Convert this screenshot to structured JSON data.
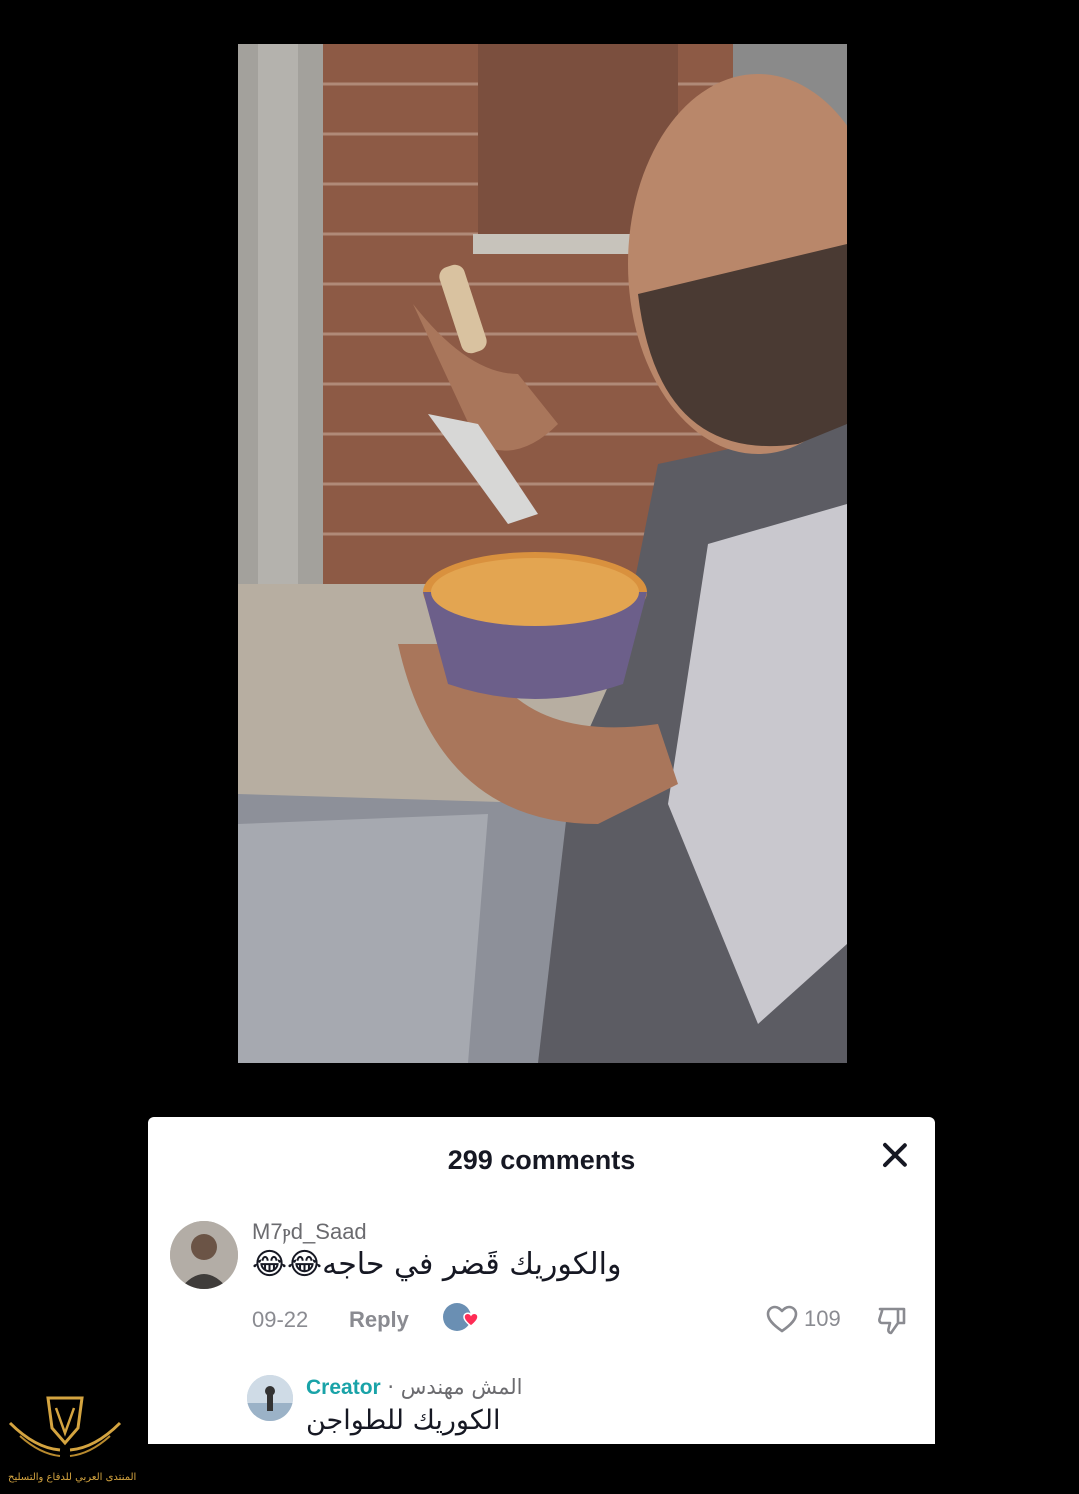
{
  "photo": {
    "description_icon": "construction-worker-eating-photo"
  },
  "comments_panel": {
    "title": "299 comments",
    "close_icon": "close-icon",
    "comment": {
      "username": "M7ⲣd_Saad",
      "text": "والكوريك قَضر في حاجه😂😂",
      "date": "09-22",
      "reply_label": "Reply",
      "likes": "109"
    },
    "reply": {
      "creator_label": "Creator",
      "separator": " · ",
      "username": "المش مهندس",
      "text": "الكوريك للطواجن"
    }
  },
  "watermark": {
    "text": "المنتدى العربي للدفاع والتسليح",
    "color": "#d4a440"
  }
}
